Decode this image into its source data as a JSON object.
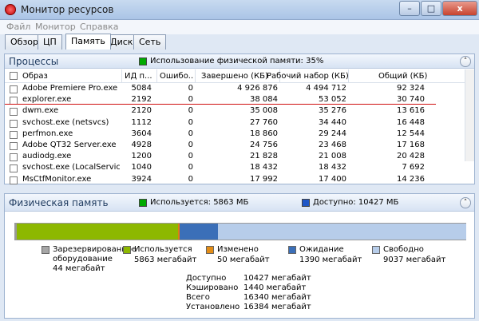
{
  "window": {
    "title": "Монитор ресурсов",
    "minimize": "–",
    "maximize": "□",
    "close": "x"
  },
  "menu": [
    "Файл",
    "Монитор",
    "Справка"
  ],
  "tabs": [
    "Обзор",
    "ЦП",
    "Память",
    "Диск",
    "Сеть"
  ],
  "processes": {
    "title": "Процессы",
    "legend": "Использование физической памяти: 35%",
    "legend_color": "#00aa00",
    "collapse": "˄",
    "columns": [
      "Образ",
      "ИД п...",
      "Ошибо...",
      "Завершено (КБ)",
      "Рабочий набор (КБ)",
      "Общий (КБ)"
    ],
    "rows": [
      [
        "Adobe Premiere Pro.exe",
        "5084",
        "0",
        "4 926 876",
        "4 494 712",
        "92 324"
      ],
      [
        "explorer.exe",
        "2192",
        "0",
        "38 084",
        "53 052",
        "30 740"
      ],
      [
        "dwm.exe",
        "2120",
        "0",
        "35 008",
        "35 276",
        "13 616"
      ],
      [
        "svchost.exe (netsvcs)",
        "1112",
        "0",
        "27 760",
        "34 440",
        "16 448"
      ],
      [
        "perfmon.exe",
        "3604",
        "0",
        "18 860",
        "29 244",
        "12 544"
      ],
      [
        "Adobe QT32 Server.exe",
        "4928",
        "0",
        "24 756",
        "23 468",
        "17 168"
      ],
      [
        "audiodg.exe",
        "1200",
        "0",
        "21 828",
        "21 008",
        "20 428"
      ],
      [
        "svchost.exe (LocalServiceNet...",
        "1040",
        "0",
        "18 432",
        "18 432",
        "7 692"
      ],
      [
        "MsCtfMonitor.exe",
        "3924",
        "0",
        "17 992",
        "17 400",
        "14 236"
      ]
    ]
  },
  "physical": {
    "title": "Физическая память",
    "legend_used": "Используется: 5863 МБ",
    "legend_available": "Доступно: 10427 МБ",
    "collapse": "˄",
    "bar": [
      {
        "name": "reserved",
        "mb": 44,
        "color": "#9a9a9a"
      },
      {
        "name": "in-use",
        "mb": 5863,
        "color": "#8db800"
      },
      {
        "name": "modified",
        "mb": 50,
        "color": "#e17b13"
      },
      {
        "name": "standby",
        "mb": 1390,
        "color": "#3b6fb8"
      },
      {
        "name": "free",
        "mb": 9037,
        "color": "#b7cdea"
      }
    ],
    "legend_items": [
      {
        "label": "Зарезервированное",
        "label2": "оборудование",
        "value": "44 мегабайт",
        "color": "#a6a6a6"
      },
      {
        "label": "Используется",
        "value": "5863 мегабайт",
        "color": "#8db800"
      },
      {
        "label": "Изменено",
        "value": "50 мегабайт",
        "color": "#e38d17"
      },
      {
        "label": "Ожидание",
        "value": "1390 мегабайт",
        "color": "#3b6fb8"
      },
      {
        "label": "Свободно",
        "value": "9037 мегабайт",
        "color": "#b7cdea"
      }
    ],
    "stats": [
      {
        "label": "Доступно",
        "value": "10427 мегабайт"
      },
      {
        "label": "Кэшировано",
        "value": "1440 мегабайт"
      },
      {
        "label": "Всего",
        "value": "16340 мегабайт"
      },
      {
        "label": "Установлено",
        "value": "16384 мегабайт"
      }
    ]
  }
}
